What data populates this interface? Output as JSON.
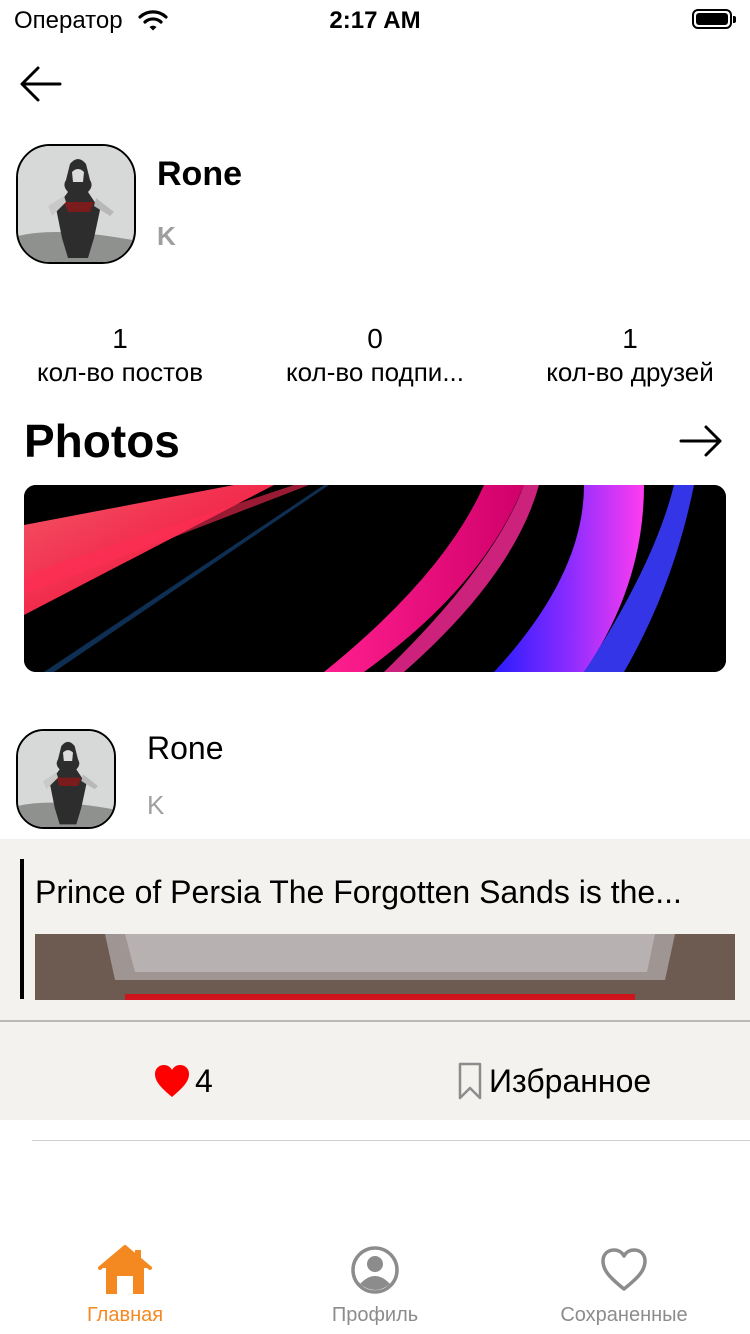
{
  "status_bar": {
    "carrier": "Оператор",
    "time": "2:17 AM"
  },
  "profile": {
    "name": "Rone",
    "subtitle": "K"
  },
  "stats": [
    {
      "value": "1",
      "label": "кол-во постов"
    },
    {
      "value": "0",
      "label": "кол-во подпи..."
    },
    {
      "value": "1",
      "label": "кол-во друзей"
    }
  ],
  "photos": {
    "title": "Photos"
  },
  "post": {
    "author": "Rone",
    "author_subtitle": "K",
    "text": "Prince of Persia The Forgotten Sands is the...",
    "likes": "4",
    "favorite_label": "Избранное"
  },
  "tabbar": {
    "items": [
      {
        "label": "Главная",
        "active": true
      },
      {
        "label": "Профиль",
        "active": false
      },
      {
        "label": "Сохраненные",
        "active": false
      }
    ]
  },
  "colors": {
    "accent": "#f48921",
    "like": "#ff0000",
    "muted": "#9e9e9e",
    "card_bg": "#f3f2ee"
  }
}
